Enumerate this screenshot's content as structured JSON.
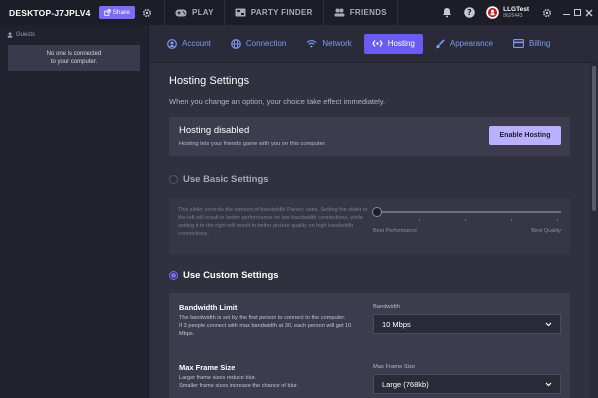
{
  "topbar": {
    "machine_name": "DESKTOP-J7JPLV4",
    "share_label": "Share",
    "nav": [
      {
        "label": "PLAY",
        "icon": "gamepad-icon"
      },
      {
        "label": "PARTY FINDER",
        "icon": "party-finder-icon"
      },
      {
        "label": "FRIENDS",
        "icon": "friends-icon"
      }
    ],
    "user": {
      "name": "LLGTest",
      "id": "8626443"
    }
  },
  "sidebar": {
    "guests_label": "Guests",
    "empty_line1": "No one is connected",
    "empty_line2": "to your computer."
  },
  "tabs": [
    {
      "label": "Account",
      "icon": "account-icon",
      "active": false
    },
    {
      "label": "Connection",
      "icon": "globe-icon",
      "active": false
    },
    {
      "label": "Network",
      "icon": "wifi-icon",
      "active": false
    },
    {
      "label": "Hosting",
      "icon": "hosting-icon",
      "active": true
    },
    {
      "label": "Appearance",
      "icon": "brush-icon",
      "active": false
    },
    {
      "label": "Billing",
      "icon": "billing-icon",
      "active": false
    }
  ],
  "main": {
    "title": "Hosting Settings",
    "subtitle": "When you change an option, your choice take effect immediately.",
    "hosting": {
      "status": "Hosting disabled",
      "description": "Hosting lets your friends game with you on this computer.",
      "button": "Enable Hosting"
    },
    "basic": {
      "label": "Use Basic Settings",
      "selected": false,
      "description": "This slider controls the amount of bandwidth Parsec uses. Setting the slider to the left will result in better performance on low bandwidth connections, while setting it to the right will result in better picture quality on high bandwidth connections.",
      "left_label": "Best Performance",
      "right_label": "Best Quality",
      "slider_value": 0
    },
    "custom": {
      "label": "Use Custom Settings",
      "selected": true,
      "bandwidth": {
        "title": "Bandwidth Limit",
        "desc1": "The bandwidth is set by the first person to connect to the computer.",
        "desc2": "If 3 people connect with max bandwidth at 30, each person will get 10 Mbps.",
        "field_label": "Bandwidth",
        "value": "10 Mbps"
      },
      "frame": {
        "title": "Max Frame Size",
        "desc1": "Larger frame sizes reduce blur.",
        "desc2": "Smaller frame sizes increase the chance of blur.",
        "field_label": "Max Frame Size",
        "value": "Large (768kb)"
      }
    }
  },
  "colors": {
    "accent": "#6a5cf2",
    "button": "#b9b1ff",
    "background": "#30303f"
  }
}
